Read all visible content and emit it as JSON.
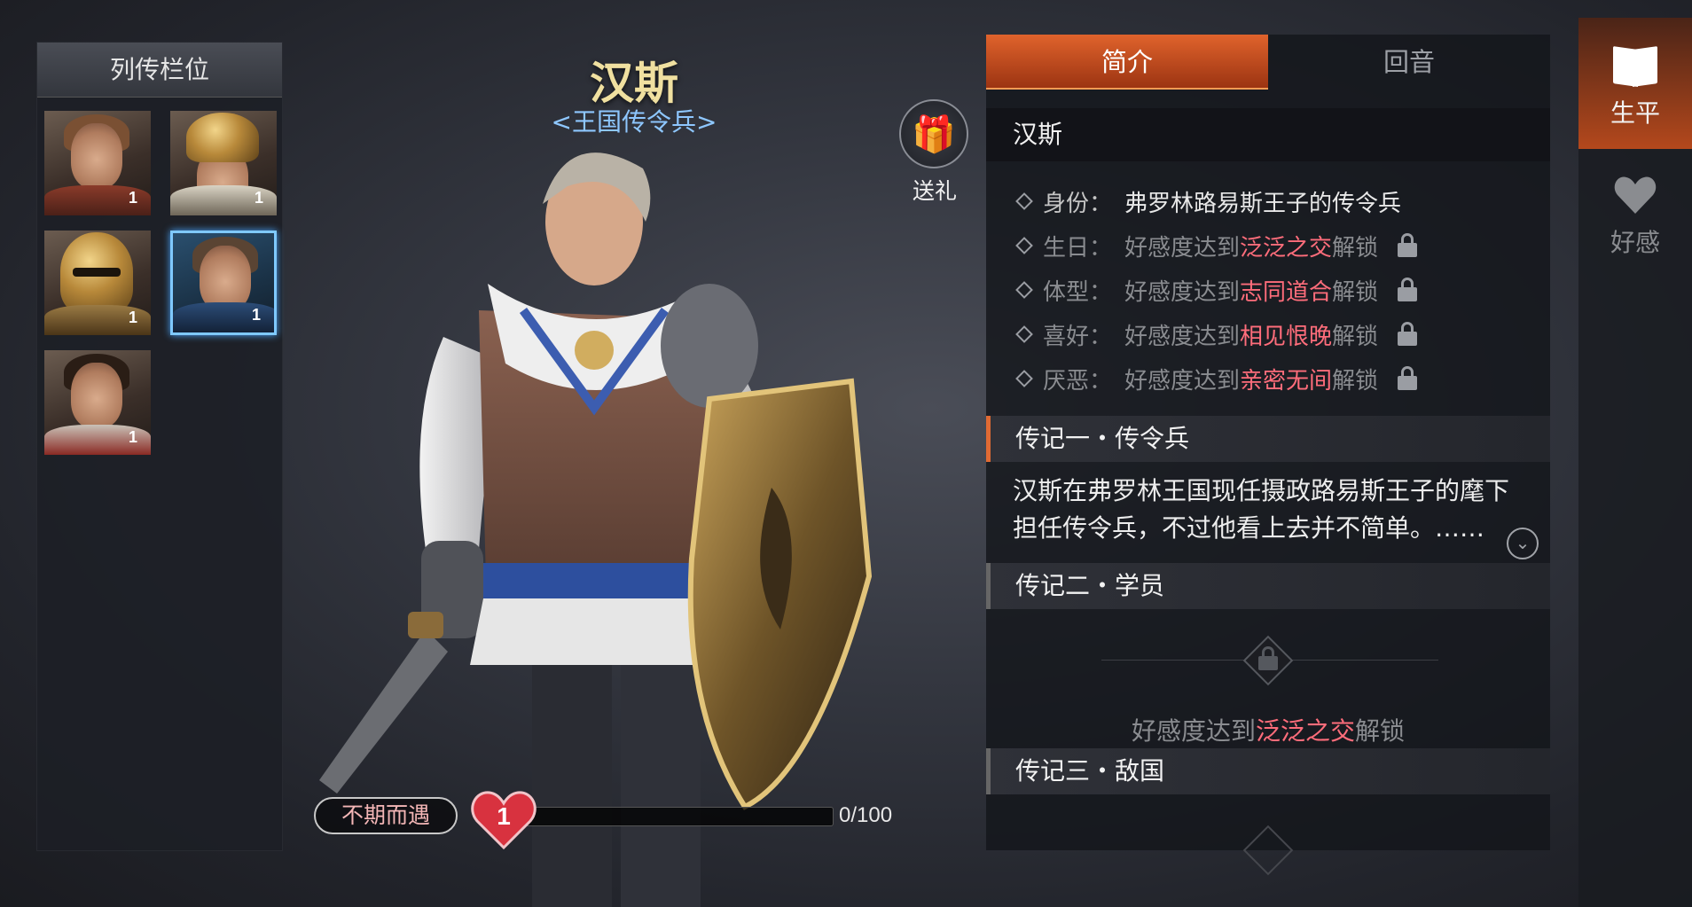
{
  "roster": {
    "title": "列传栏位",
    "slots": [
      {
        "name": "female-hero",
        "affection": "1"
      },
      {
        "name": "gold-helmet-warrior",
        "affection": "1"
      },
      {
        "name": "gold-mask-knight",
        "affection": "1"
      },
      {
        "name": "hans",
        "affection": "1",
        "selected": true
      },
      {
        "name": "red-scarf-warrior",
        "affection": "1"
      }
    ]
  },
  "character": {
    "name": "汉斯",
    "title": "<王国传令兵>"
  },
  "gift": {
    "label": "送礼",
    "icon": "gift-icon"
  },
  "affection": {
    "status": "不期而遇",
    "level": "1",
    "progress_text": "0/100",
    "progress_fraction": 0
  },
  "info": {
    "tabs": [
      "简介",
      "回音"
    ],
    "active_tab": 0,
    "section_name": "汉斯",
    "attributes": [
      {
        "key": "身份：",
        "value": "弗罗林路易斯王子的传令兵",
        "locked": false
      },
      {
        "key": "生日：",
        "prefix": "好感度达到",
        "highlight": "泛泛之交",
        "suffix": "解锁",
        "locked": true
      },
      {
        "key": "体型：",
        "prefix": "好感度达到",
        "highlight": "志同道合",
        "suffix": "解锁",
        "locked": true
      },
      {
        "key": "喜好：",
        "prefix": "好感度达到",
        "highlight": "相见恨晚",
        "suffix": "解锁",
        "locked": true
      },
      {
        "key": "厌恶：",
        "prefix": "好感度达到",
        "highlight": "亲密无间",
        "suffix": "解锁",
        "locked": true
      }
    ],
    "bio1": {
      "heading": "传记一・传令兵",
      "text": "汉斯在弗罗林王国现任摄政路易斯王子的麾下担任传令兵，不过他看上去并不简单。……"
    },
    "bio2": {
      "heading": "传记二・学员",
      "lock_prefix": "好感度达到",
      "lock_highlight": "泛泛之交",
      "lock_suffix": "解锁"
    },
    "bio3": {
      "heading": "传记三・敌国"
    }
  },
  "side_tabs": [
    {
      "label": "生平",
      "icon": "book-icon",
      "active": true
    },
    {
      "label": "好感",
      "icon": "heart-icon",
      "active": false
    }
  ],
  "colors": {
    "accent_orange": "#e0632c",
    "highlight_red": "#ff6d7b",
    "title_blue": "#8ec7ff",
    "name_gold": "#f0e0a0"
  }
}
